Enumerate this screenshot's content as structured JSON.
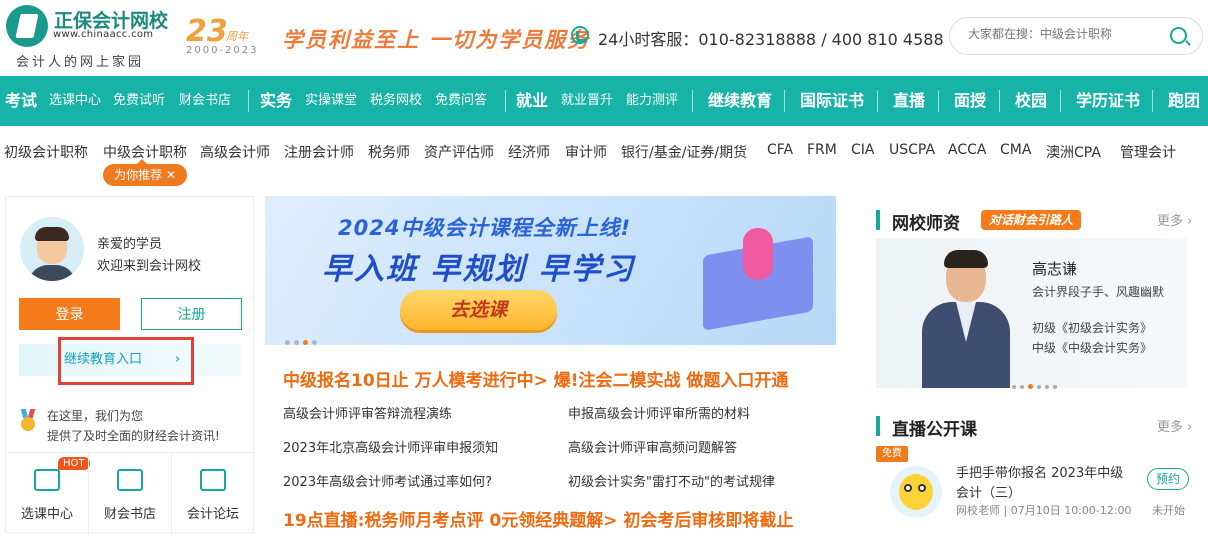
{
  "header": {
    "logo_name": "正保会计网校",
    "logo_url": "www.chinaacc.com",
    "logo_slogan": "会计人的网上家园",
    "anniv_number": "23",
    "anniv_suffix": "周年",
    "anniv_years": "2000-2023",
    "motto": "学员利益至上  一切为学员服务",
    "hotline": "24小时客服：010-82318888 / 400 810 4588",
    "search_placeholder": "大家都在搜：中级会计职称"
  },
  "nav": [
    {
      "label": "考试",
      "big": true
    },
    {
      "label": "选课中心"
    },
    {
      "label": "免费试听"
    },
    {
      "label": "财会书店"
    },
    {
      "label": "实务",
      "big": true
    },
    {
      "label": "实操课堂"
    },
    {
      "label": "税务网校"
    },
    {
      "label": "免费问答"
    },
    {
      "label": "就业",
      "big": true
    },
    {
      "label": "就业晋升"
    },
    {
      "label": "能力测评"
    },
    {
      "label": "继续教育",
      "big": true
    },
    {
      "label": "国际证书",
      "big": true
    },
    {
      "label": "直播",
      "big": true
    },
    {
      "label": "面授",
      "big": true
    },
    {
      "label": "校园",
      "big": true
    },
    {
      "label": "学历证书",
      "big": true
    },
    {
      "label": "跑团",
      "big": true
    }
  ],
  "subnav": [
    "初级会计职称",
    "中级会计职称",
    "高级会计师",
    "注册会计师",
    "税务师",
    "资产评估师",
    "经济师",
    "审计师",
    "银行/基金/证券/期货",
    "CFA",
    "FRM",
    "CIA",
    "USCPA",
    "ACCA",
    "CMA",
    "澳洲CPA",
    "管理会计"
  ],
  "recommend_tag": "为你推荐 ✕",
  "user_panel": {
    "greeting": "亲爱的学员",
    "welcome": "欢迎来到会计网校",
    "login": "登录",
    "register": "注册",
    "continuing_edu": "继续教育入口",
    "continuing_edu_arrow": "›",
    "info_line1": "在这里，我们为您",
    "info_line2": "提供了及时全面的财经会计资讯!",
    "quick_links": [
      {
        "label": "选课中心",
        "icon": "monitor-icon",
        "badge": "HOT"
      },
      {
        "label": "财会书店",
        "icon": "book-icon"
      },
      {
        "label": "会计论坛",
        "icon": "chat-icon"
      }
    ]
  },
  "banner": {
    "title": "2024中级会计课程全新上线!",
    "subtitle": "早入班 早规划 早学习",
    "button": "去选课"
  },
  "news": {
    "headline1": "中级报名10日止  万人模考进行中>  爆!注会二模实战 做题入口开通",
    "items": [
      "高级会计师评审答辩流程演练",
      "申报高级会计师评审所需的材料",
      "2023年北京高级会计师评审申报须知",
      "高级会计师评审高频问题解答",
      "2023年高级会计师考试通过率如何?",
      "初级会计实务\"雷打不动\"的考试规律"
    ],
    "headline2": "19点直播:税务师月考点评  0元领经典题解>  初会考后审核即将截止"
  },
  "teachers": {
    "title": "网校师资",
    "tag": "对话财会引路人",
    "more": "更多 ›",
    "name": "高志谦",
    "desc": "会计界段子手、风趣幽默",
    "course1": "初级《初级会计实务》",
    "course2": "中级《中级会计实务》"
  },
  "live": {
    "title": "直播公开课",
    "more": "更多 ›",
    "free": "免费",
    "course_line1": "手把手带你报名 2023年中级",
    "course_line2": "会计（三）",
    "meta": "网校老师 | 07月10日 10:00-12:00",
    "status": "未开始",
    "reserve": "预约"
  },
  "colors": {
    "brand": "#16b3a6",
    "accent": "#f47a1a",
    "highlight": "#e0413a"
  }
}
